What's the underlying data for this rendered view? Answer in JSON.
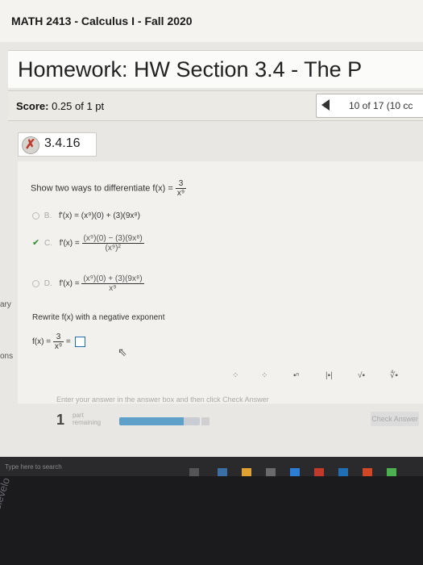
{
  "course": {
    "title": "MATH 2413 - Calculus I - Fall 2020"
  },
  "homework": {
    "title": "Homework: HW Section 3.4 - The P"
  },
  "score": {
    "label": "Score:",
    "value": "0.25 of 1 pt"
  },
  "navigation": {
    "count": "10 of 17 (10 cc"
  },
  "question": {
    "id": "3.4.16",
    "prompt": "Show two ways to differentiate f(x) =",
    "f_num": "3",
    "f_den": "x⁹"
  },
  "options": [
    {
      "letter": "B.",
      "expr": "f'(x) = (x⁹)(0) + (3)(9x⁸)"
    },
    {
      "letter": "C.",
      "lhs": "f'(x) =",
      "num": "(x⁹)(0) − (3)(9x⁸)",
      "den": "(x⁹)²"
    },
    {
      "letter": "D.",
      "lhs": "f'(x) =",
      "num": "(x⁹)(0) + (3)(9x⁸)",
      "den": "x⁹"
    }
  ],
  "sidebar": {
    "text1": "ary",
    "text2": "ons"
  },
  "rewrite": {
    "instruction": "Rewrite f(x) with a negative exponent",
    "lhs": "f(x) =",
    "num": "3",
    "den": "x⁹",
    "eq": "="
  },
  "toolbar": {
    "t1": "⁘",
    "t2": "⁘",
    "t3": "▪ⁿ",
    "t4": "|▪|",
    "t5": "√▪",
    "t6": "∜▪"
  },
  "hint": {
    "text": "Enter your answer in the answer box and then click Check Answer"
  },
  "parts": {
    "count": "1",
    "label1": "part",
    "label2": "remaining",
    "progress": 0.8
  },
  "check_button": {
    "label": "Check Answer"
  },
  "taskbar": {
    "search_placeholder": "Type here to search"
  },
  "watermark": {
    "text": "@caslevelo"
  }
}
